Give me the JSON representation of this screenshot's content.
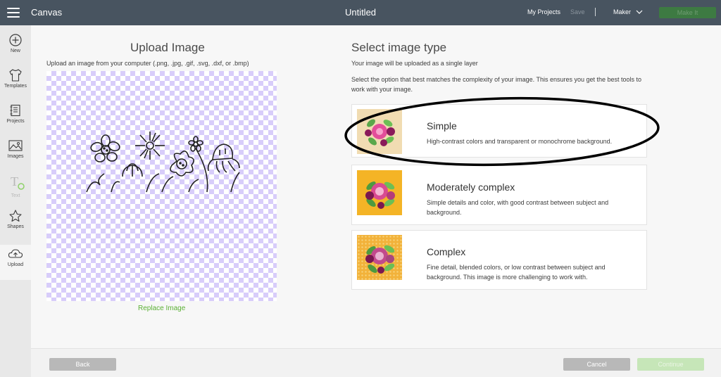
{
  "topbar": {
    "app_name": "Canvas",
    "document_title": "Untitled",
    "my_projects": "My Projects",
    "save": "Save",
    "machine": "Maker",
    "make_it": "Make It"
  },
  "sidebar": {
    "items": [
      {
        "label": "New",
        "icon": "plus-circle-icon"
      },
      {
        "label": "Templates",
        "icon": "tshirt-icon"
      },
      {
        "label": "Projects",
        "icon": "projects-icon"
      },
      {
        "label": "Images",
        "icon": "image-icon"
      },
      {
        "label": "Text",
        "icon": "text-icon"
      },
      {
        "label": "Shapes",
        "icon": "shapes-icon"
      },
      {
        "label": "Upload",
        "icon": "upload-icon"
      }
    ]
  },
  "upload": {
    "title": "Upload Image",
    "subtitle": "Upload an image from your computer (.png, .jpg, .gif, .svg, .dxf, or .bmp)",
    "replace": "Replace Image"
  },
  "image_type": {
    "title": "Select image type",
    "subtitle": "Your image will be uploaded as a single layer",
    "description": "Select the option that best matches the complexity of your image. This ensures you get the best tools to work with your image.",
    "options": [
      {
        "title": "Simple",
        "description": "High-contrast colors and transparent or monochrome background.",
        "thumb_bg": "#f1dcb2"
      },
      {
        "title": "Moderately complex",
        "description": "Simple details and color, with good contrast between subject and background.",
        "thumb_bg": "#f4b426"
      },
      {
        "title": "Complex",
        "description": "Fine detail, blended colors, or low contrast between subject and background. This image is more challenging to work with.",
        "thumb_bg": "#f2b23a"
      }
    ]
  },
  "footer": {
    "back": "Back",
    "cancel": "Cancel",
    "continue": "Continue"
  },
  "colors": {
    "topbar": "#485460",
    "accent_green": "#5bb035",
    "checker_purple": "#d8cdfa"
  }
}
